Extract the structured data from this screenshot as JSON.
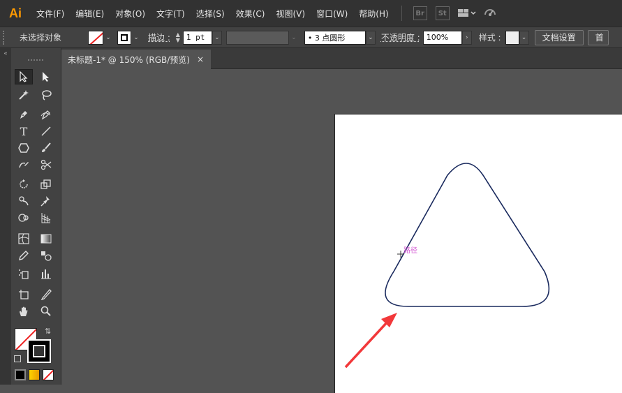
{
  "app": {
    "logo": "Ai"
  },
  "menu": {
    "items": [
      "文件(F)",
      "编辑(E)",
      "对象(O)",
      "文字(T)",
      "选择(S)",
      "效果(C)",
      "视图(V)",
      "窗口(W)",
      "帮助(H)"
    ],
    "bridge": "Br",
    "stock": "St"
  },
  "control": {
    "selection_label": "未选择对象",
    "stroke_label": "描边 :",
    "stroke_weight": "1 pt",
    "brush_label": "• 3 点圆形",
    "opacity_label": "不透明度 :",
    "opacity_value": "100%",
    "style_label": "样式 :",
    "doc_settings": "文档设置",
    "prefs_partial": "首"
  },
  "document": {
    "tab_title": "未标题-1* @ 150% (RGB/预览)",
    "close_glyph": "×"
  },
  "canvas": {
    "hint_label": "路径"
  },
  "colors": {
    "path_stroke": "#1a2a5e",
    "hint_color": "#d45ad4",
    "arrow_color": "#f2383a",
    "logo_color": "#ff9a00"
  },
  "icons": {
    "tools": [
      "selection-tool",
      "direct-selection-tool",
      "magic-wand-tool",
      "lasso-tool",
      "pen-tool",
      "curvature-tool",
      "type-tool",
      "line-segment-tool",
      "shape-tool",
      "paintbrush-tool",
      "shaper-tool",
      "scissors-tool",
      "rotate-tool",
      "scale-tool",
      "puppet-warp-tool",
      "pin-tool",
      "shape-builder-tool",
      "perspective-grid-tool",
      "mesh-tool",
      "gradient-tool",
      "eyedropper-tool",
      "blend-tool",
      "symbol-sprayer-tool",
      "column-graph-tool",
      "artboard-tool",
      "slice-tool",
      "hand-tool",
      "zoom-tool"
    ]
  }
}
